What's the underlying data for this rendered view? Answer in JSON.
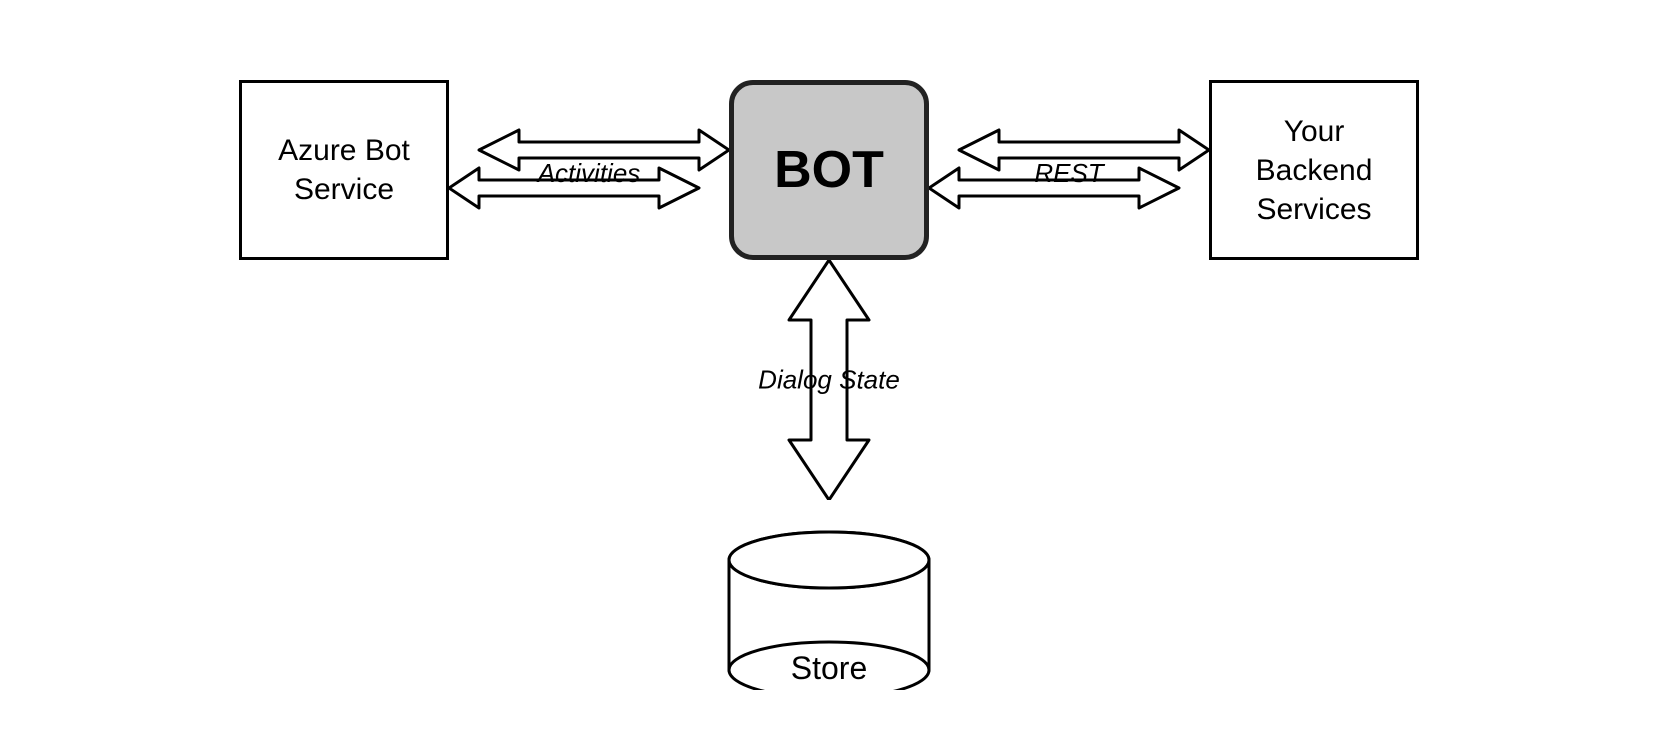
{
  "diagram": {
    "azure_box": {
      "line1": "Azure Bot",
      "line2": "Service"
    },
    "bot_box": {
      "label": "BOT"
    },
    "backend_box": {
      "line1": "Your Backend",
      "line2": "Services"
    },
    "left_arrow_label": "Activities",
    "right_arrow_label": "REST",
    "vertical_arrow_label": "Dialog State",
    "store_label": "Store"
  }
}
